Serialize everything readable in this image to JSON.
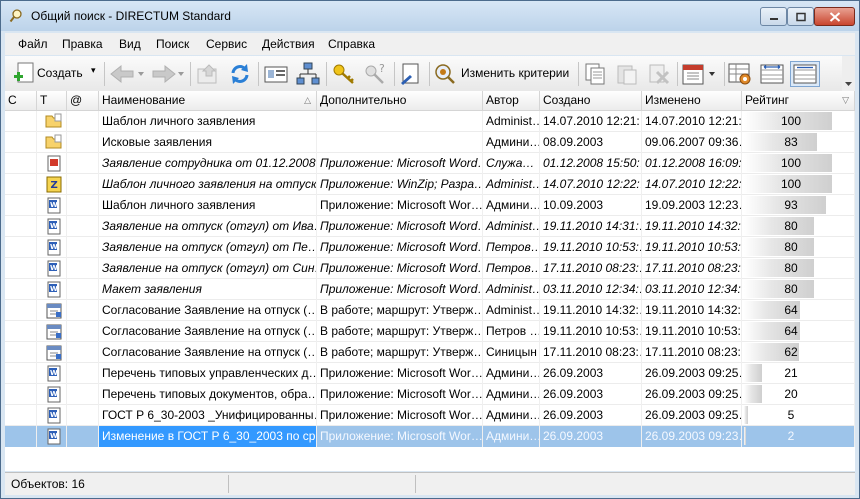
{
  "window": {
    "title": "Общий поиск - DIRECTUM Standard"
  },
  "menu": [
    "Файл",
    "Правка",
    "Вид",
    "Поиск",
    "Сервис",
    "Действия",
    "Справка"
  ],
  "toolbar": {
    "create_label": "Создать",
    "change_criteria_label": "Изменить критерии"
  },
  "columns": [
    "С",
    "Т",
    "@",
    "Наименование",
    "Дополнительно",
    "Автор",
    "Создано",
    "Изменено",
    "Рейтинг"
  ],
  "rows": [
    {
      "icon": "folder-icon",
      "name": "Шаблон личного заявления",
      "extra": "",
      "author": "Administ…",
      "created": "14.07.2010 12:21:…",
      "modified": "14.07.2010 12:21:…",
      "rating": "100",
      "italic": false
    },
    {
      "icon": "folder-icon",
      "name": "Исковые заявления",
      "extra": "",
      "author": "Админи…",
      "created": "08.09.2003",
      "modified": "09.06.2007 09:36…",
      "rating": "83",
      "italic": false
    },
    {
      "icon": "pdf-doc-icon",
      "name": "Заявление сотрудника от 01.12.2008…",
      "extra": "Приложение: Microsoft Word…",
      "author": "Служа…",
      "created": "01.12.2008 15:50:…",
      "modified": "01.12.2008 16:09:…",
      "rating": "100",
      "italic": true
    },
    {
      "icon": "winzip-doc-icon",
      "name": "Шаблон личного заявления на отпуск",
      "extra": "Приложение: WinZip; Разра…",
      "author": "Administ…",
      "created": "14.07.2010 12:22:…",
      "modified": "14.07.2010 12:22:…",
      "rating": "100",
      "italic": true
    },
    {
      "icon": "word-doc-icon",
      "name": "Шаблон личного заявления",
      "extra": "Приложение: Microsoft Wor…",
      "author": "Админи…",
      "created": "10.09.2003",
      "modified": "19.09.2003 12:23…",
      "rating": "93",
      "italic": false
    },
    {
      "icon": "word-doc-icon",
      "name": "Заявление на отпуск (отгул) от Ива…",
      "extra": "Приложение: Microsoft Word…",
      "author": "Administ…",
      "created": "19.11.2010 14:31:…",
      "modified": "19.11.2010 14:32:…",
      "rating": "80",
      "italic": true
    },
    {
      "icon": "word-doc-icon",
      "name": "Заявление на отпуск (отгул) от Пе…",
      "extra": "Приложение: Microsoft Word…",
      "author": "Петров…",
      "created": "19.11.2010 10:53:…",
      "modified": "19.11.2010 10:53:…",
      "rating": "80",
      "italic": true
    },
    {
      "icon": "word-doc-icon",
      "name": "Заявление на отпуск (отгул) от Син…",
      "extra": "Приложение: Microsoft Word…",
      "author": "Петров…",
      "created": "17.11.2010 08:23:…",
      "modified": "17.11.2010 08:23:…",
      "rating": "80",
      "italic": true
    },
    {
      "icon": "word-doc-icon",
      "name": "Макет заявления",
      "extra": "Приложение: Microsoft Word…",
      "author": "Administ…",
      "created": "03.11.2010 12:34:…",
      "modified": "03.11.2010 12:34:…",
      "rating": "80",
      "italic": true
    },
    {
      "icon": "task-icon",
      "name": "Согласование Заявление на отпуск (…",
      "extra": "В работе; маршрут: Утверж…",
      "author": "Administ…",
      "created": "19.11.2010 14:32:…",
      "modified": "19.11.2010 14:32:…",
      "rating": "64",
      "italic": false
    },
    {
      "icon": "task-icon",
      "name": "Согласование Заявление на отпуск (…",
      "extra": "В работе; маршрут: Утверж…",
      "author": "Петров …",
      "created": "19.11.2010 10:53:…",
      "modified": "19.11.2010 10:53:…",
      "rating": "64",
      "italic": false
    },
    {
      "icon": "task-icon",
      "name": "Согласование Заявление на отпуск (…",
      "extra": "В работе; маршрут: Утверж…",
      "author": "Синицын",
      "created": "17.11.2010 08:23:…",
      "modified": "17.11.2010 08:23:…",
      "rating": "62",
      "italic": false
    },
    {
      "icon": "word-doc-icon",
      "name": "Перечень типовых управленческих д…",
      "extra": "Приложение: Microsoft Wor…",
      "author": "Админи…",
      "created": "26.09.2003",
      "modified": "26.09.2003 09:25…",
      "rating": "21",
      "italic": false
    },
    {
      "icon": "word-doc-icon",
      "name": "Перечень типовых документов, обра…",
      "extra": "Приложение: Microsoft Wor…",
      "author": "Админи…",
      "created": "26.09.2003",
      "modified": "26.09.2003 09:25…",
      "rating": "20",
      "italic": false
    },
    {
      "icon": "word-doc-icon",
      "name": "ГОСТ Р 6_30-2003 _Унифицированны…",
      "extra": "Приложение: Microsoft Wor…",
      "author": "Админи…",
      "created": "26.09.2003",
      "modified": "26.09.2003 09:25…",
      "rating": "5",
      "italic": false
    },
    {
      "icon": "word-doc-icon",
      "name": "Изменение в ГОСТ Р 6_30_2003 по ср…",
      "extra": "Приложение: Microsoft Wor…",
      "author": "Админи…",
      "created": "26.09.2003",
      "modified": "26.09.2003 09:23…",
      "rating": "2",
      "italic": false,
      "selected": true
    }
  ],
  "status": {
    "count_text": "Объектов: 16"
  },
  "colors": {
    "selection": "#3399ff",
    "title_bg": "#c9dcf0"
  }
}
